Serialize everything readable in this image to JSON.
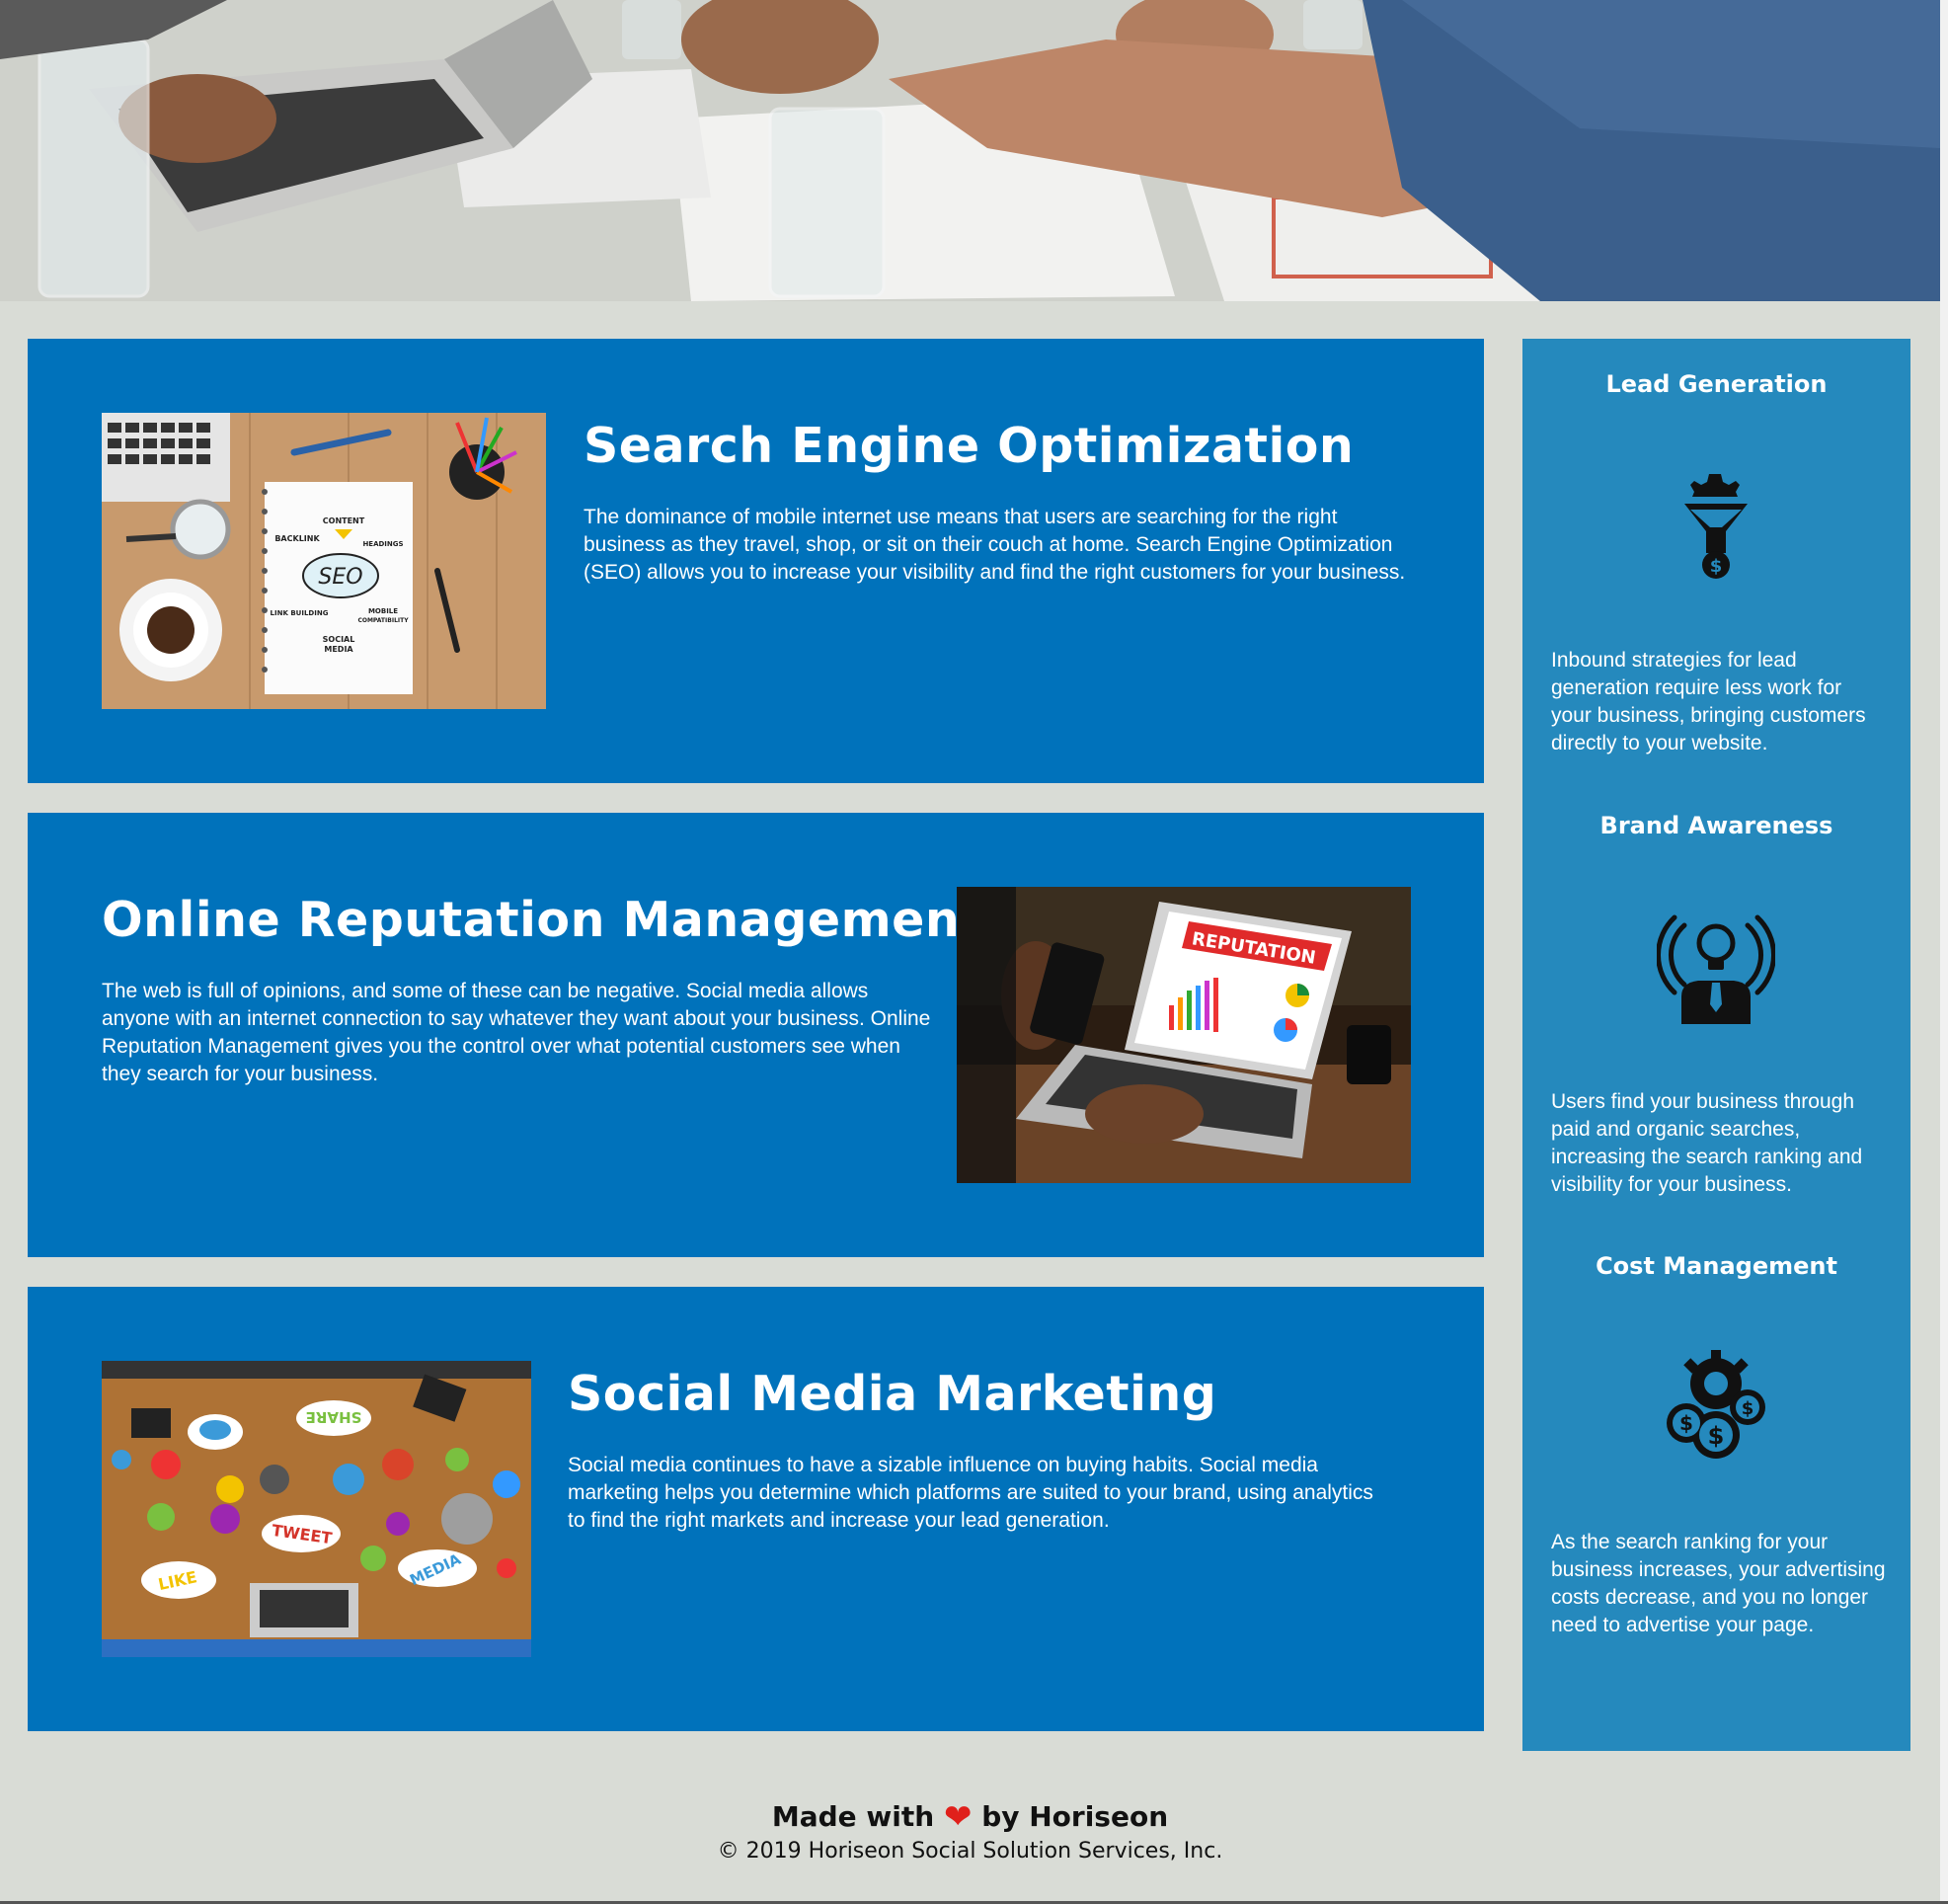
{
  "main": {
    "sections": [
      {
        "id": "seo",
        "title": "Search Engine Optimization",
        "text": "The dominance of mobile internet use means that users are searching for the right business as they travel, shop, or sit on their couch at home. Search Engine Optimization (SEO) allows you to increase your visibility and find the right customers for your business.",
        "image_labels": [
          "CONTENT",
          "BACKLINK",
          "HEADINGS",
          "SEO",
          "LINK BUILDING",
          "MOBILE COMPATIBILITY",
          "SOCIAL MEDIA"
        ]
      },
      {
        "id": "orm",
        "title": "Online Reputation Management",
        "text": "The web is full of opinions, and some of these can be negative. Social media allows anyone with an internet connection to say whatever they want about your business. Online Reputation Management gives you the control over what potential customers see when they search for your business.",
        "image_labels": [
          "REPUTATION"
        ]
      },
      {
        "id": "smm",
        "title": "Social Media Marketing",
        "text": "Social media continues to have a sizable influence on buying habits. Social media marketing helps you determine which platforms are suited to your brand, using analytics to find the right markets and increase your lead generation.",
        "image_labels": [
          "SHARE",
          "TWEET",
          "LIKE",
          "MEDIA"
        ]
      }
    ]
  },
  "sidebar": {
    "benefits": [
      {
        "title": "Lead Generation",
        "icon": "lead-funnel-icon",
        "text": "Inbound strategies for lead generation require less work for your business, bringing customers directly to your website."
      },
      {
        "title": "Brand Awareness",
        "icon": "lightbulb-broadcast-icon",
        "text": "Users find your business through paid and organic searches, increasing the search ranking and visibility for your business."
      },
      {
        "title": "Cost Management",
        "icon": "coins-gear-icon",
        "text": "As the search ranking for your business increases, your advertising costs decrease, and you no longer need to advertise your page."
      }
    ]
  },
  "footer": {
    "made_prefix": "Made with",
    "heart": "❤",
    "made_suffix": "by Horiseon",
    "copyright": "© 2019 Horiseon Social Solution Services, Inc."
  },
  "colors": {
    "page_bg": "#d9dcd6",
    "card_bg": "#0072bb",
    "sidebar_bg": "#2589bd",
    "heart": "#e0201b"
  }
}
